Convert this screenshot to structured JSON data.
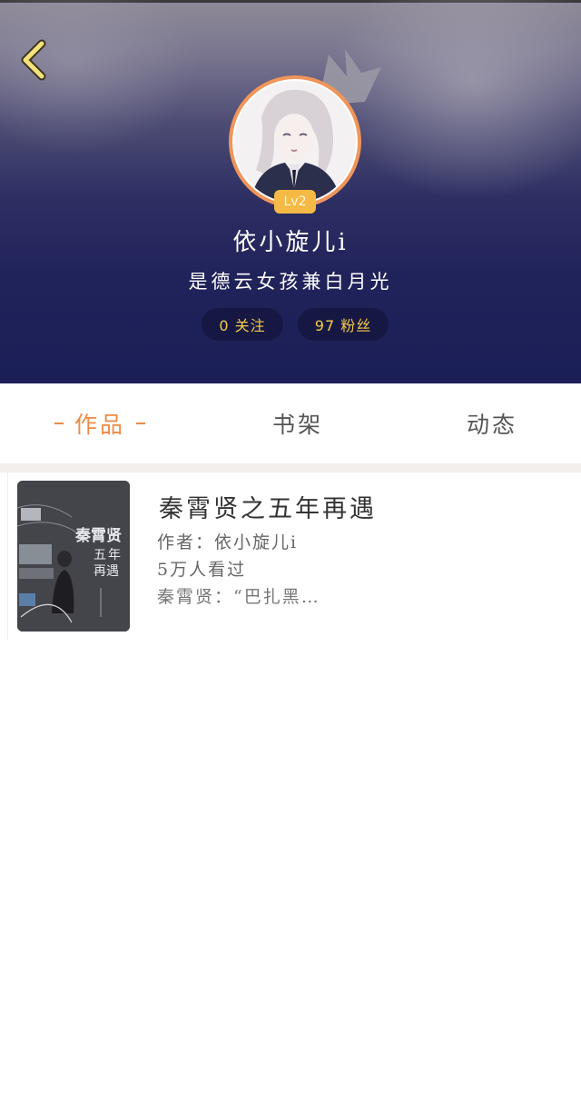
{
  "profile": {
    "level": "Lv2",
    "username": "依小旋儿i",
    "bio": "是德云女孩兼白月光",
    "following": "0 关注",
    "fans": "97 粉丝"
  },
  "tabs": [
    {
      "label": "作品",
      "active": true
    },
    {
      "label": "书架",
      "active": false
    },
    {
      "label": "动态",
      "active": false
    }
  ],
  "works": [
    {
      "title": "秦霄贤之五年再遇",
      "author": "作者：依小旋儿i",
      "views": "5万人看过",
      "snippet": "秦霄贤：“巴扎黑…",
      "cover_text": [
        "秦霄贤",
        "五",
        "年",
        "再遇"
      ]
    }
  ],
  "colors": {
    "accent": "#ef8a45",
    "badge": "#f5b946",
    "stat_text": "#f5c947",
    "header_dark": "#1c1f57"
  },
  "icons": {
    "back": "chevron-left-icon",
    "crown": "crown-icon"
  }
}
